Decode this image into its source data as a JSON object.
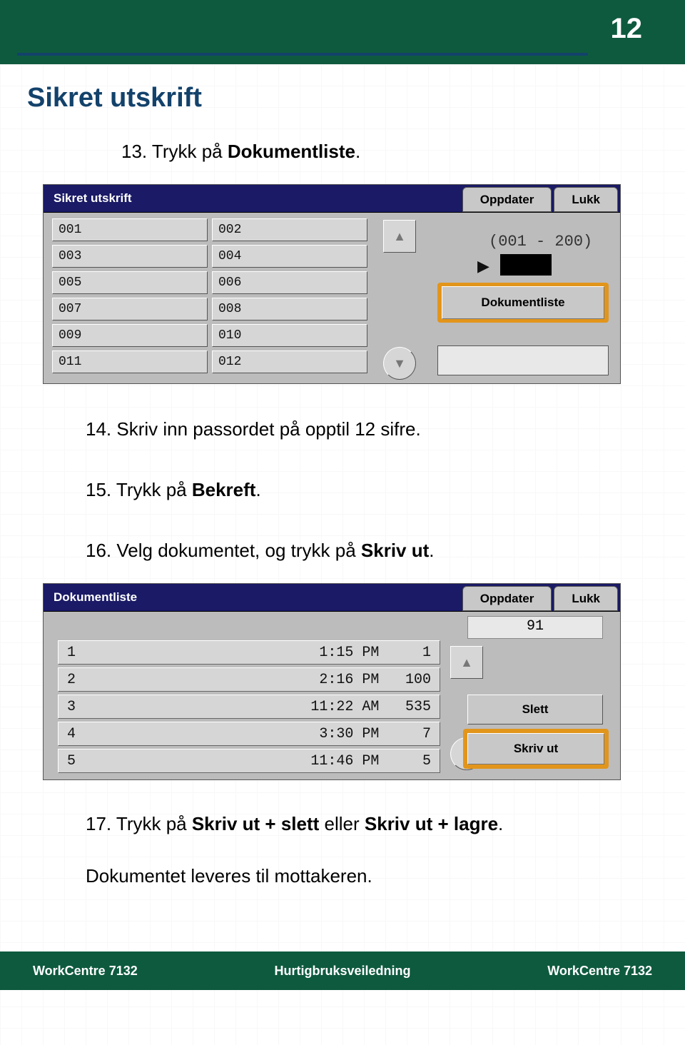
{
  "page_number": "12",
  "title": "Sikret utskrift",
  "steps": {
    "s13_pre": "13.  Trykk på ",
    "s13_bold": "Dokumentliste",
    "s13_post": ".",
    "s14": "14.  Skriv inn passordet på opptil 12 sifre.",
    "s15_pre": "15.  Trykk på ",
    "s15_bold": "Bekreft",
    "s15_post": ".",
    "s16_pre": "16.  Velg dokumentet, og trykk på ",
    "s16_bold": "Skriv ut",
    "s16_post": ".",
    "s17_pre": "17. Trykk på ",
    "s17_b1": "Skriv ut + slett",
    "s17_mid": " eller ",
    "s17_b2": "Skriv ut + lagre",
    "s17_post": ".",
    "s18": "Dokumentet leveres til mottakeren."
  },
  "panel1": {
    "title": "Sikret utskrift",
    "btn_update": "Oppdater",
    "btn_close": "Lukk",
    "left": [
      "001",
      "003",
      "005",
      "007",
      "009",
      "011"
    ],
    "right": [
      "002",
      "004",
      "006",
      "008",
      "010",
      "012"
    ],
    "range": "(001 - 200)",
    "doc_button": "Dokumentliste"
  },
  "panel2": {
    "title": "Dokumentliste",
    "btn_update": "Oppdater",
    "btn_close": "Lukk",
    "counter": "91",
    "rows": [
      {
        "n": "1",
        "t": "1:15 PM",
        "c": "1"
      },
      {
        "n": "2",
        "t": "2:16 PM",
        "c": "100"
      },
      {
        "n": "3",
        "t": "11:22 AM",
        "c": "535"
      },
      {
        "n": "4",
        "t": "3:30 PM",
        "c": "7"
      },
      {
        "n": "5",
        "t": "11:46 PM",
        "c": "5"
      }
    ],
    "btn_delete": "Slett",
    "btn_print": "Skriv ut"
  },
  "footer": {
    "left": "WorkCentre 7132",
    "center": "Hurtigbruksveiledning",
    "right": "WorkCentre 7132"
  }
}
